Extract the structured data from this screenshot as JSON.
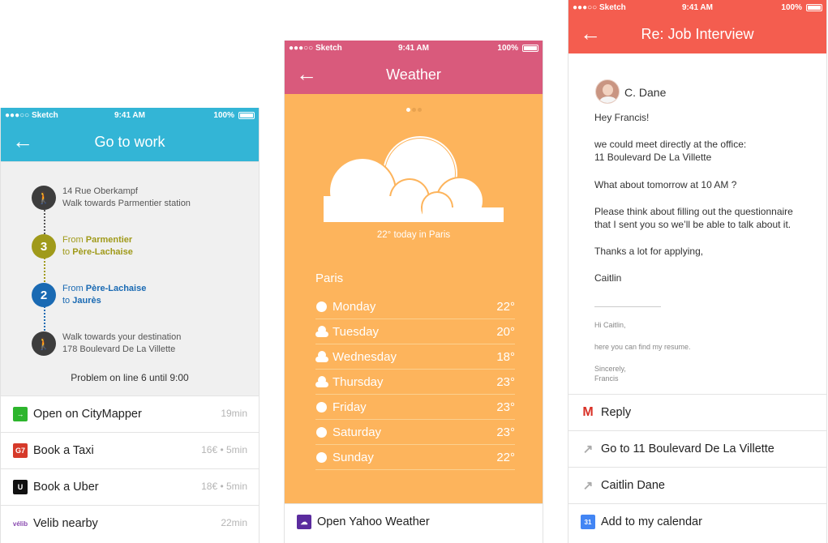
{
  "status": {
    "carrier": "●●●○○ Sketch",
    "time": "9:41 AM",
    "battery": "100%"
  },
  "work": {
    "title": "Go to work",
    "back": "←",
    "steps": [
      {
        "line1": "14 Rue Oberkampf",
        "line2": "Walk towards Parmentier station"
      },
      {
        "badge": "3",
        "from_prefix": "From ",
        "from": "Parmentier",
        "to_prefix": "to ",
        "to": "Père-Lachaise",
        "color": "#a09a1a"
      },
      {
        "badge": "2",
        "from_prefix": "From ",
        "from": "Père-Lachaise",
        "to_prefix": "to ",
        "to": "Jaurès",
        "color": "#1a6ab3"
      },
      {
        "line1": "Walk towards your destination",
        "line2": "178 Boulevard De La Villette"
      }
    ],
    "walk_icon": "person-walking-icon",
    "problem": "Problem on line 6 until 9:00",
    "actions": [
      {
        "label": "Open on CityMapper",
        "meta": "19min",
        "icon": "citymapper-icon",
        "color": "#2db52d"
      },
      {
        "label": "Book a Taxi",
        "meta": "16€ • 5min",
        "icon": "g7-taxi-icon",
        "color": "#d63a2a"
      },
      {
        "label": "Book a Uber",
        "meta": "18€ • 5min",
        "icon": "uber-icon",
        "color": "#111111"
      },
      {
        "label": "Velib nearby",
        "meta": "22min",
        "icon": "velib-icon",
        "color": "#8a4bb0"
      }
    ]
  },
  "weather": {
    "title": "Weather",
    "back": "←",
    "caption": "22° today in Paris",
    "city": "Paris",
    "days": [
      {
        "day": "Monday",
        "temp": "22°",
        "icon": "sun-icon"
      },
      {
        "day": "Tuesday",
        "temp": "20°",
        "icon": "partly-cloudy-icon"
      },
      {
        "day": "Wednesday",
        "temp": "18°",
        "icon": "partly-cloudy-icon"
      },
      {
        "day": "Thursday",
        "temp": "23°",
        "icon": "partly-cloudy-icon"
      },
      {
        "day": "Friday",
        "temp": "23°",
        "icon": "sun-icon"
      },
      {
        "day": "Saturday",
        "temp": "23°",
        "icon": "sun-icon"
      },
      {
        "day": "Sunday",
        "temp": "22°",
        "icon": "sun-icon"
      }
    ],
    "action": {
      "label": "Open Yahoo Weather",
      "icon": "yahoo-weather-icon",
      "color": "#5b2c9e"
    }
  },
  "mail": {
    "title": "Re: Job Interview",
    "back": "←",
    "sender": "C. Dane",
    "lines": [
      "Hey Francis!",
      "we could meet directly at the office:",
      "11 Boulevard De La Villette",
      "What about tomorrow at 10 AM ?",
      "Please think about filling out the questionnaire",
      "that I sent you so we’ll be able to talk about it.",
      "Thanks a lot for applying,",
      "Caitlin"
    ],
    "quoted": [
      "Hi Caitlin,",
      "here you can find my resume.",
      "Sincerely,",
      "Francis"
    ],
    "actions": [
      {
        "label": "Reply",
        "icon": "gmail-icon",
        "color": "#d93025"
      },
      {
        "label": "Go to 11 Boulevard De La Villette",
        "icon": "arrow-up-right-icon",
        "color": "#aaaaaa"
      },
      {
        "label": "Caitlin Dane",
        "icon": "arrow-up-right-icon",
        "color": "#aaaaaa"
      },
      {
        "label": "Add to my calendar",
        "icon": "calendar-icon",
        "color": "#4285f4"
      }
    ]
  }
}
